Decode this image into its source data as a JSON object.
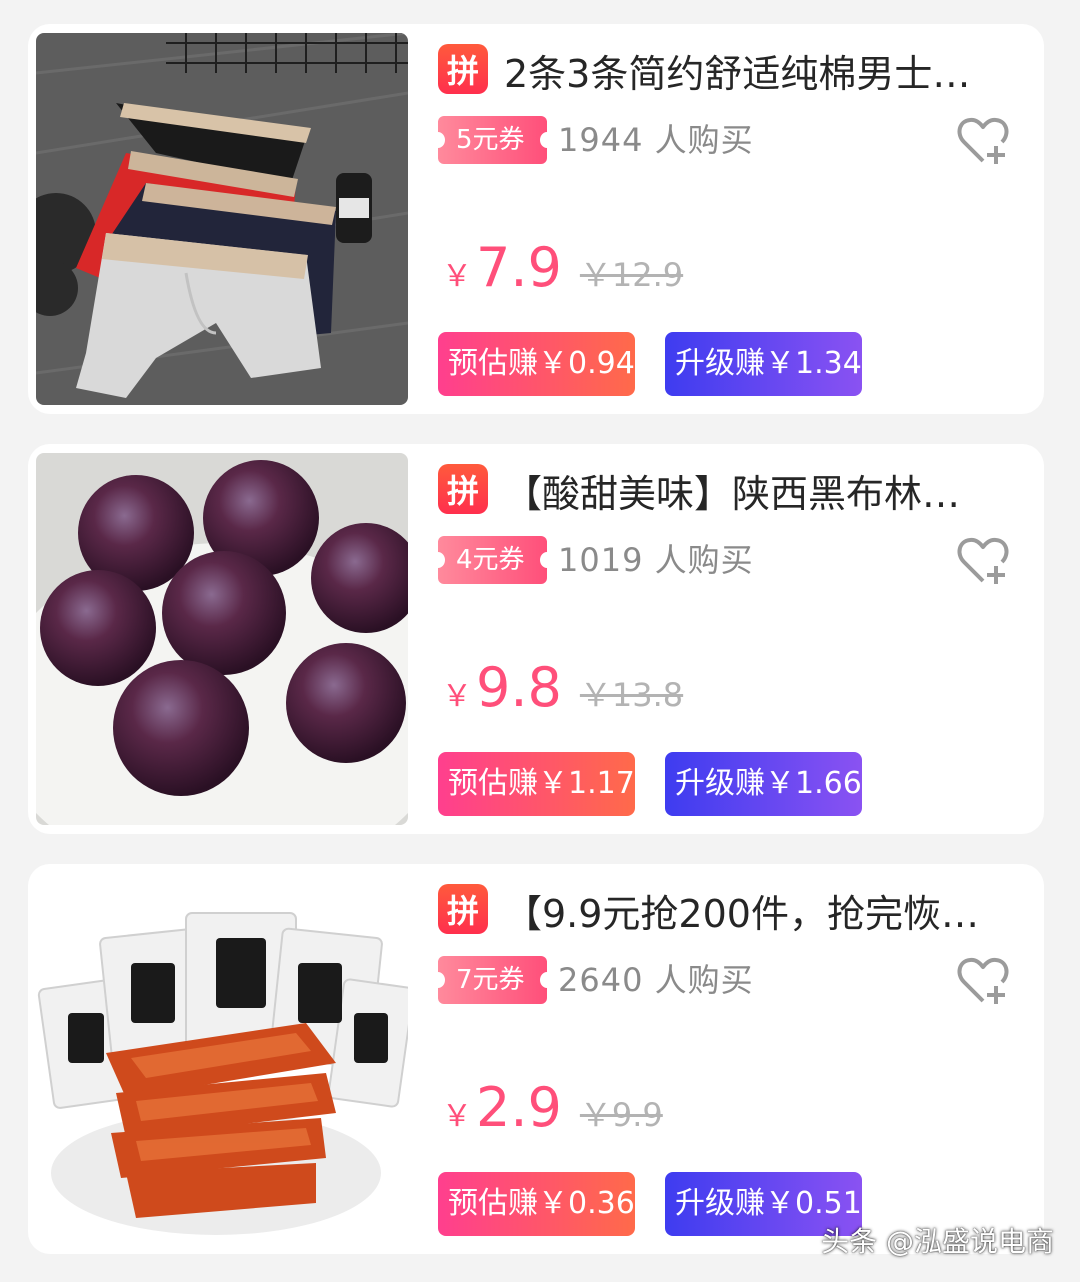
{
  "products": [
    {
      "badge": "拼",
      "title": "2条3条简约舒适纯棉男士…",
      "coupon": "5元券",
      "buyers": "1944 人购买",
      "currency": "￥",
      "price": "7.9",
      "original_price": "￥12.9",
      "estimated_earn": "预估赚￥0.94",
      "upgrade_earn": "升级赚￥1.34",
      "image_icon": "underwear-photo"
    },
    {
      "badge": "拼",
      "title": "【酸甜美味】陕西黑布林…",
      "coupon": "4元券",
      "buyers": "1019 人购买",
      "currency": "￥",
      "price": "9.8",
      "original_price": "￥13.8",
      "estimated_earn": "预估赚￥1.17",
      "upgrade_earn": "升级赚￥1.66",
      "image_icon": "plums-photo"
    },
    {
      "badge": "拼",
      "title": "【9.9元抢200件，抢完恢…",
      "coupon": "7元券",
      "buyers": "2640 人购买",
      "currency": "￥",
      "price": "2.9",
      "original_price": "￥9.9",
      "estimated_earn": "预估赚￥0.36",
      "upgrade_earn": "升级赚￥0.51",
      "image_icon": "spicy-snack-photo"
    }
  ],
  "watermark": "头条 @泓盛说电商",
  "colors": {
    "price_pink": "#ff4f7a",
    "badge_red": "#ff2f4d",
    "upgrade_purple": "#5a46f0",
    "background": "#f3f3f3"
  }
}
